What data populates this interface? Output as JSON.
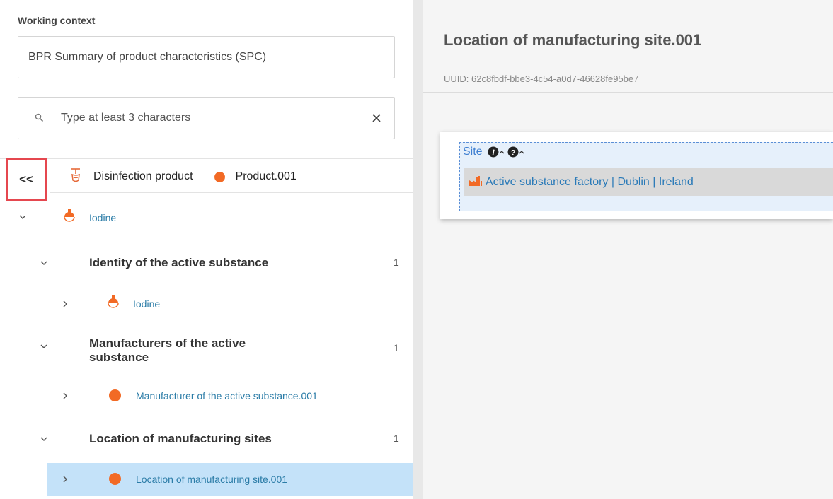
{
  "sidebar": {
    "context_label": "Working context",
    "context_value": "BPR Summary of product characteristics (SPC)",
    "search_placeholder": "Type at least 3 characters",
    "collapse_label": "<<",
    "root": {
      "dataset_type": "Disinfection product",
      "dataset_name": "Product.001"
    },
    "tree": {
      "substance": "Iodine",
      "sections": [
        {
          "title": "Identity of the active substance",
          "count": "1",
          "child": "Iodine"
        },
        {
          "title_line1": "Manufacturers of the active",
          "title_line2": "substance",
          "count": "1",
          "child": "Manufacturer of the active substance.001"
        },
        {
          "title": "Location of manufacturing sites",
          "count": "1",
          "child": "Location of manufacturing site.001"
        }
      ]
    }
  },
  "main": {
    "title": "Location of manufacturing site.001",
    "uuid": "UUID: 62c8fbdf-bbe3-4c54-a0d7-46628fe95be7",
    "site_label": "Site",
    "site_reference": "Active substance factory | Dublin | Ireland"
  },
  "colors": {
    "accent_orange": "#f26a25",
    "link_blue": "#2b7ca7",
    "highlight_red": "#e5474f",
    "selection_blue": "#c4e2f9"
  },
  "icons": {
    "search": "search-icon",
    "clear": "close-icon",
    "product": "disinfection-product-icon",
    "substance": "flask-icon",
    "factory": "factory-icon",
    "info": "info-icon",
    "help": "help-icon"
  }
}
